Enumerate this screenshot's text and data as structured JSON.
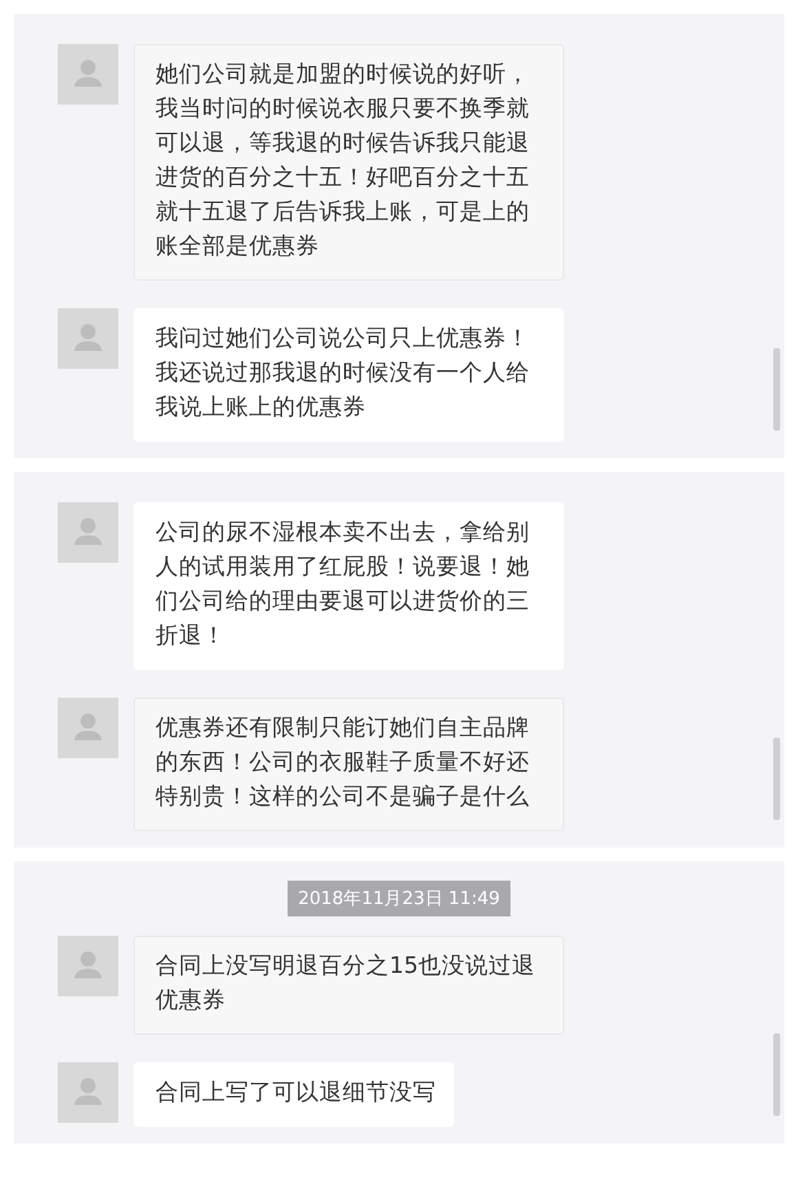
{
  "panels": [
    {
      "messages": [
        {
          "text": "她们公司就是加盟的时候说的好听，我当时问的时候说衣服只要不换季就可以退，等我退的时候告诉我只能退进货的百分之十五！好吧百分之十五就十五退了后告诉我上账，可是上的账全部是优惠券",
          "highlighted": false
        },
        {
          "text": "我问过她们公司说公司只上优惠券！我还说过那我退的时候没有一个人给我说上账上的优惠券",
          "highlighted": true
        }
      ]
    },
    {
      "messages": [
        {
          "text": "公司的尿不湿根本卖不出去，拿给别人的试用装用了红屁股！说要退！她们公司给的理由要退可以进货价的三折退！",
          "highlighted": true
        },
        {
          "text": "优惠券还有限制只能订她们自主品牌的东西！公司的衣服鞋子质量不好还特别贵！这样的公司不是骗子是什么",
          "highlighted": false
        }
      ]
    },
    {
      "timestamp": "2018年11月23日 11:49",
      "messages": [
        {
          "text": "合同上没写明退百分之15也没说过退优惠券",
          "highlighted": false
        },
        {
          "text": "合同上写了可以退细节没写",
          "highlighted": true
        }
      ]
    }
  ]
}
